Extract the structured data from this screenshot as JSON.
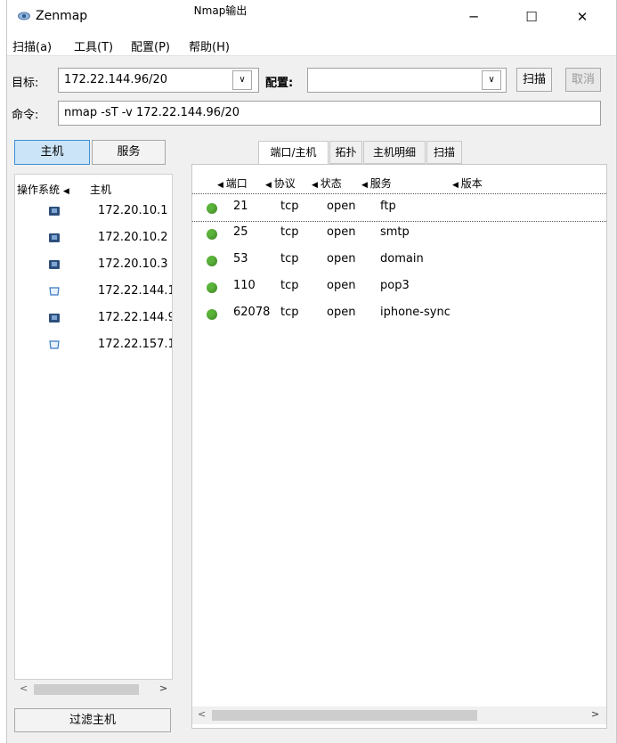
{
  "window": {
    "title": "Zenmap"
  },
  "window_controls": {
    "minimize": "─",
    "maximize": "☐",
    "close": "✕"
  },
  "menu": [
    "扫描(a)",
    "工具(T)",
    "配置(P)",
    "帮助(H)"
  ],
  "toolbar": {
    "target_label": "目标:",
    "target_value": "172.22.144.96/20",
    "profile_label": "配置:",
    "profile_value": "",
    "scan_button": "扫描",
    "cancel_button": "取消",
    "command_label": "命令:",
    "command_value": "nmap -sT -v 172.22.144.96/20"
  },
  "left_panel": {
    "hosts_button": "主机",
    "services_button": "服务",
    "columns": {
      "os": "操作系统",
      "host": "主机"
    },
    "hosts": [
      {
        "ip": "172.20.10.1",
        "icon": "host-windows-icon"
      },
      {
        "ip": "172.20.10.2",
        "icon": "host-windows-icon"
      },
      {
        "ip": "172.20.10.3",
        "icon": "host-windows-icon"
      },
      {
        "ip": "172.22.144.1",
        "icon": "host-unknown-icon"
      },
      {
        "ip": "172.22.144.9",
        "icon": "host-windows-icon"
      },
      {
        "ip": "172.22.157.1",
        "icon": "host-unknown-icon"
      }
    ],
    "filter_button": "过滤主机"
  },
  "tabs": [
    "Nmap输出",
    "端口/主机",
    "拓扑",
    "主机明细",
    "扫描"
  ],
  "active_tab": "端口/主机",
  "ports_table": {
    "columns": [
      "端口",
      "协议",
      "状态",
      "服务",
      "版本"
    ],
    "rows": [
      {
        "port": "21",
        "protocol": "tcp",
        "state": "open",
        "service": "ftp",
        "version": ""
      },
      {
        "port": "25",
        "protocol": "tcp",
        "state": "open",
        "service": "smtp",
        "version": ""
      },
      {
        "port": "53",
        "protocol": "tcp",
        "state": "open",
        "service": "domain",
        "version": ""
      },
      {
        "port": "110",
        "protocol": "tcp",
        "state": "open",
        "service": "pop3",
        "version": ""
      },
      {
        "port": "62078",
        "protocol": "tcp",
        "state": "open",
        "service": "iphone-sync",
        "version": ""
      }
    ]
  },
  "colors": {
    "open_port": "#5ab43a",
    "host_icon": "#2d4f7c",
    "active_button": "#cce4f7"
  }
}
